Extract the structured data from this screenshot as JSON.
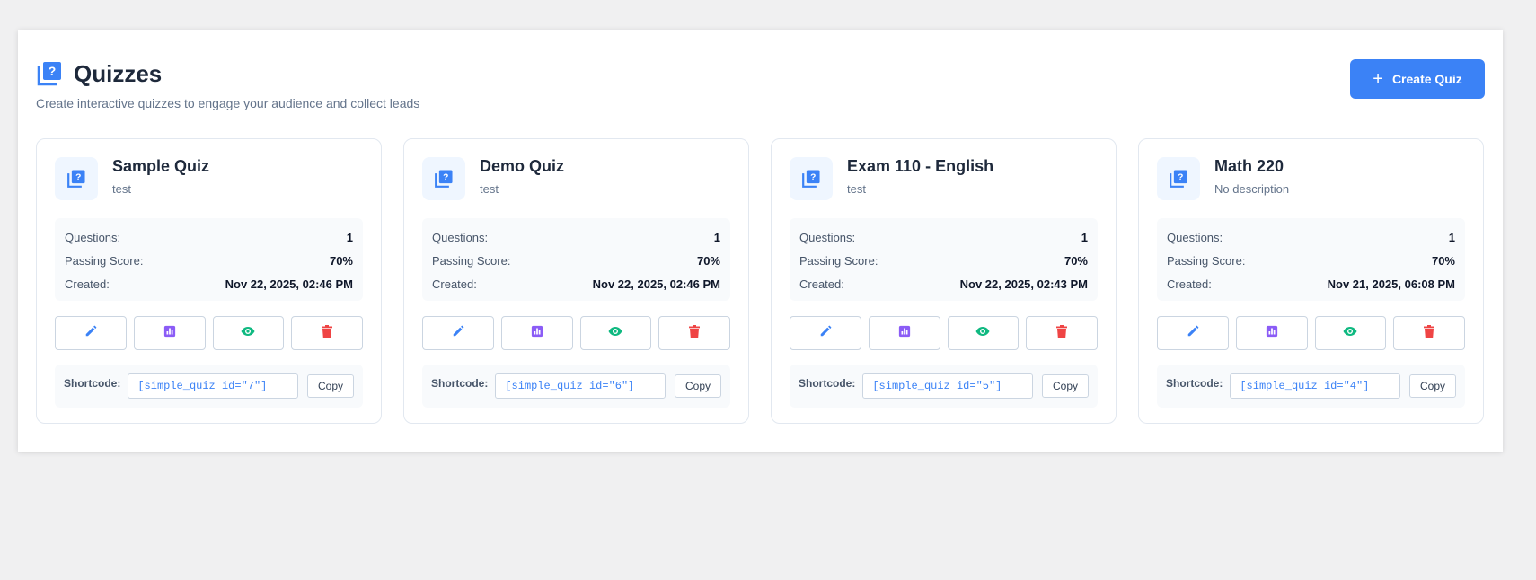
{
  "header": {
    "title": "Quizzes",
    "subtitle": "Create interactive quizzes to engage your audience and collect leads",
    "create_label": "Create Quiz"
  },
  "labels": {
    "questions": "Questions:",
    "passing": "Passing Score:",
    "created": "Created:",
    "shortcode": "Shortcode:",
    "copy": "Copy"
  },
  "colors": {
    "accent": "#3b82f6",
    "edit": "#3b82f6",
    "stats": "#8b5cf6",
    "view": "#10b981",
    "delete": "#ef4444"
  },
  "quizzes": [
    {
      "title": "Sample Quiz",
      "description": "test",
      "questions": "1",
      "passing_score": "70%",
      "created": "Nov 22, 2025, 02:46 PM",
      "shortcode": "[simple_quiz id=\"7\"]"
    },
    {
      "title": "Demo Quiz",
      "description": "test",
      "questions": "1",
      "passing_score": "70%",
      "created": "Nov 22, 2025, 02:46 PM",
      "shortcode": "[simple_quiz id=\"6\"]"
    },
    {
      "title": "Exam 110 - English",
      "description": "test",
      "questions": "1",
      "passing_score": "70%",
      "created": "Nov 22, 2025, 02:43 PM",
      "shortcode": "[simple_quiz id=\"5\"]"
    },
    {
      "title": "Math 220",
      "description": "No description",
      "questions": "1",
      "passing_score": "70%",
      "created": "Nov 21, 2025, 06:08 PM",
      "shortcode": "[simple_quiz id=\"4\"]"
    }
  ]
}
